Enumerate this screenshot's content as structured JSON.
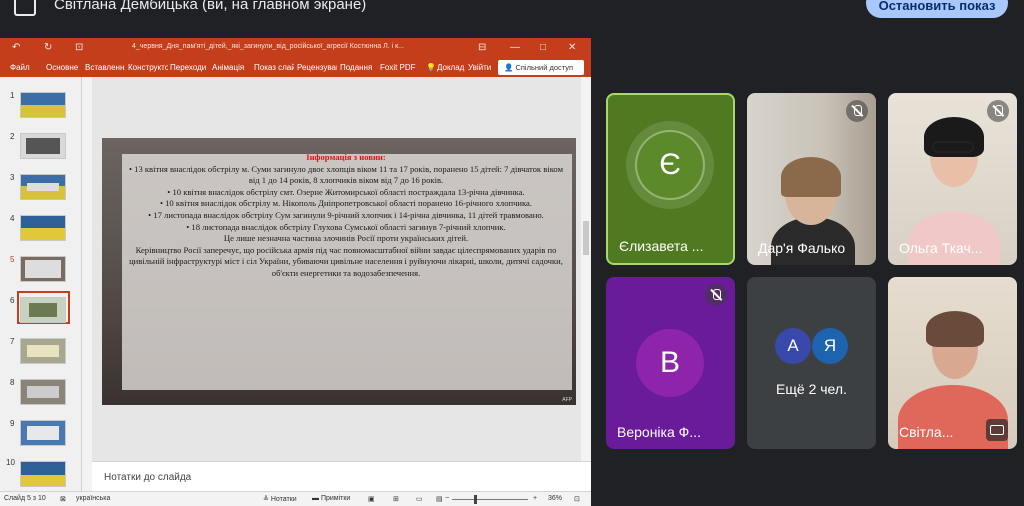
{
  "meet": {
    "presenting_text": "Світлана Дембицька (ви, на главном экране)",
    "stop_button": "Остановить показ"
  },
  "ppt": {
    "title": "4_червня_Дня_пам'яті_дітей,_які_загинули_від_російської_агресії Костюнна Л. і к...",
    "tabs": [
      "Файл",
      "Основне",
      "Вставлення",
      "Конструктор",
      "Переходи",
      "Анімація",
      "Показ слайдів",
      "Рецензування",
      "Подання",
      "Foxit PDF",
      "Доклад",
      "Увійти"
    ],
    "share_label": "Спільний доступ",
    "slide_numbers": [
      "1",
      "2",
      "3",
      "4",
      "5",
      "6",
      "7",
      "8",
      "9",
      "10"
    ],
    "selected_slide": 5,
    "slide": {
      "heading": "Інформація з новин:",
      "lines": [
        "• 13 квітня внаслідок обстрілу м. Суми загинуло двоє хлопців віком 11 та 17 років, поранено 15 дітей: 7 дівчаток віком від 1 до 14 років, 8 хлопчиків віком від 7 до 16 років.",
        "• 10 квітня внаслідок обстрілу смт. Озерне Житомирської області постраждала 13-річна дівчинка.",
        "• 10 квітня внаслідок обстрілу м. Нікополь Дніпропетровської області поранено 16-річного хлопчика.",
        "• 17 листопада внаслідок обстрілу Сум загинули 9-річний хлопчик і 14-річна дівчинка, 11 дітей травмовано.",
        "• 18 листопада внаслідок обстрілу Глухова Сумської області загинув 7-річний хлопчик.",
        "Це лише незначна частина злочинів Росії проти українських дітей.",
        "Керівництво Росії заперечує, що російська армія під час повномасштабної війни завдає цілеспрямованих ударів по цивільній інфраструктурі міст і сіл України, убиваючи цивільне населення і руйнуючи лікарні, школи, дитячі садочки, об'єкти енергетики та водозабезпечення."
      ],
      "credit": "AFP"
    },
    "notes_placeholder": "Нотатки до слайда",
    "status": {
      "slide_of": "Слайд 5 з 10",
      "language": "українська",
      "notes": "Нотатки",
      "comments": "Примітки",
      "zoom": "36%"
    }
  },
  "participants": [
    {
      "name": "Єлизавета ...",
      "initial": "Є",
      "color": "#5c8a2a",
      "muted": false,
      "speaking": true
    },
    {
      "name": "Дар'я Фалько",
      "muted": true
    },
    {
      "name": "Ольга Ткач...",
      "muted": true
    },
    {
      "name": "Вероніка Ф...",
      "initial": "В",
      "color": "#7b1fa2",
      "muted": true
    },
    {
      "name": "Ещё 2 чел.",
      "avatars": [
        "А",
        "Я"
      ]
    },
    {
      "name": "Світла...",
      "muted": false
    }
  ]
}
